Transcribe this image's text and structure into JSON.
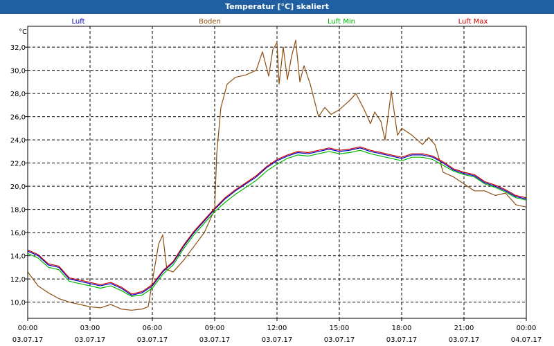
{
  "window": {
    "title": "Temperatur [°C] skaliert"
  },
  "chart_data": {
    "type": "line",
    "title": "Temperatur [°C] skaliert",
    "ylabel": "°C",
    "xlabel": "",
    "ylim": [
      8.6,
      33.8
    ],
    "y_ticks": [
      "10,0",
      "12,0",
      "14,0",
      "16,0",
      "18,0",
      "20,0",
      "22,0",
      "24,0",
      "26,0",
      "28,0",
      "30,0",
      "32,0"
    ],
    "x_range_hours": [
      0,
      24
    ],
    "x_ticks": [
      {
        "time": "00:00",
        "date": "03.07.17"
      },
      {
        "time": "03:00",
        "date": "03.07.17"
      },
      {
        "time": "06:00",
        "date": "03.07.17"
      },
      {
        "time": "09:00",
        "date": "03.07.17"
      },
      {
        "time": "12:00",
        "date": "03.07.17"
      },
      {
        "time": "15:00",
        "date": "03.07.17"
      },
      {
        "time": "18:00",
        "date": "03.07.17"
      },
      {
        "time": "21:00",
        "date": "03.07.17"
      },
      {
        "time": "00:00",
        "date": "04.07.17"
      }
    ],
    "grid": true,
    "legend_position": "top",
    "series": [
      {
        "name": "Luft",
        "color": "#0000c8",
        "x": [
          0,
          0.5,
          1,
          1.5,
          2,
          2.5,
          3,
          3.5,
          4,
          4.5,
          5,
          5.5,
          6,
          6.5,
          7,
          7.5,
          8,
          8.5,
          9,
          9.5,
          10,
          10.5,
          11,
          11.5,
          12,
          12.5,
          13,
          13.5,
          14,
          14.5,
          15,
          15.5,
          16,
          16.5,
          17,
          17.5,
          18,
          18.5,
          19,
          19.5,
          20,
          20.5,
          21,
          21.5,
          22,
          22.5,
          23,
          23.5,
          24
        ],
        "y": [
          14.4,
          14.0,
          13.2,
          13.0,
          12.0,
          11.8,
          11.6,
          11.4,
          11.6,
          11.2,
          10.6,
          10.8,
          11.4,
          12.6,
          13.4,
          14.8,
          16.0,
          17.0,
          18.0,
          18.9,
          19.6,
          20.2,
          20.8,
          21.6,
          22.2,
          22.6,
          22.9,
          22.8,
          23.0,
          23.2,
          23.0,
          23.1,
          23.3,
          23.0,
          22.8,
          22.6,
          22.4,
          22.7,
          22.7,
          22.5,
          22.0,
          21.4,
          21.1,
          20.9,
          20.3,
          20.0,
          19.6,
          19.1,
          18.9
        ]
      },
      {
        "name": "Boden",
        "color": "#8b4c0e",
        "x": [
          0,
          0.5,
          1,
          1.5,
          2,
          2.5,
          3,
          3.5,
          4,
          4.5,
          5,
          5.5,
          5.8,
          6,
          6.3,
          6.5,
          6.7,
          7,
          7.5,
          8,
          8.5,
          8.8,
          9,
          9.1,
          9.3,
          9.6,
          10,
          10.5,
          11,
          11.3,
          11.6,
          11.8,
          12,
          12.1,
          12.3,
          12.5,
          12.7,
          12.9,
          13.1,
          13.3,
          13.6,
          14,
          14.3,
          14.6,
          15,
          15.5,
          15.8,
          16.2,
          16.5,
          16.7,
          17,
          17.2,
          17.5,
          17.8,
          18,
          18.5,
          19,
          19.3,
          19.6,
          20,
          20.5,
          21,
          21.5,
          22,
          22.5,
          23,
          23.5,
          24
        ],
        "y": [
          12.6,
          11.4,
          10.8,
          10.3,
          10.0,
          9.8,
          9.6,
          9.5,
          9.8,
          9.4,
          9.3,
          9.4,
          9.6,
          11.8,
          15.0,
          15.8,
          12.8,
          12.6,
          13.6,
          14.8,
          16.0,
          17.2,
          18.0,
          22.8,
          26.8,
          28.8,
          29.4,
          29.6,
          30.0,
          31.6,
          29.5,
          31.8,
          32.4,
          28.8,
          32.0,
          29.2,
          31.2,
          32.6,
          29.0,
          30.4,
          28.8,
          26.0,
          26.8,
          26.2,
          26.6,
          27.4,
          28.0,
          26.6,
          25.4,
          26.4,
          25.6,
          24.0,
          28.2,
          24.4,
          25.0,
          24.4,
          23.6,
          24.2,
          23.6,
          21.2,
          20.8,
          20.2,
          19.6,
          19.6,
          19.2,
          19.4,
          18.4,
          18.2
        ]
      },
      {
        "name": "Luft Min",
        "color": "#00b400",
        "x": [
          0,
          0.5,
          1,
          1.5,
          2,
          2.5,
          3,
          3.5,
          4,
          4.5,
          5,
          5.5,
          6,
          6.5,
          7,
          7.5,
          8,
          8.5,
          9,
          9.5,
          10,
          10.5,
          11,
          11.5,
          12,
          12.5,
          13,
          13.5,
          14,
          14.5,
          15,
          15.5,
          16,
          16.5,
          17,
          17.5,
          18,
          18.5,
          19,
          19.5,
          20,
          20.5,
          21,
          21.5,
          22,
          22.5,
          23,
          23.5,
          24
        ],
        "y": [
          14.2,
          13.8,
          13.0,
          12.8,
          11.8,
          11.6,
          11.4,
          11.2,
          11.4,
          11.0,
          10.5,
          10.6,
          11.2,
          12.4,
          13.2,
          14.6,
          15.8,
          16.8,
          17.8,
          18.6,
          19.3,
          19.9,
          20.5,
          21.3,
          21.9,
          22.4,
          22.7,
          22.6,
          22.8,
          23.0,
          22.8,
          22.9,
          23.1,
          22.8,
          22.6,
          22.4,
          22.2,
          22.5,
          22.5,
          22.3,
          21.8,
          21.3,
          21.0,
          20.8,
          20.2,
          19.9,
          19.5,
          19.0,
          18.8
        ]
      },
      {
        "name": "Luft Max",
        "color": "#c80000",
        "x": [
          0,
          0.5,
          1,
          1.5,
          2,
          2.5,
          3,
          3.5,
          4,
          4.5,
          5,
          5.5,
          6,
          6.5,
          7,
          7.5,
          8,
          8.5,
          9,
          9.5,
          10,
          10.5,
          11,
          11.5,
          12,
          12.5,
          13,
          13.5,
          14,
          14.5,
          15,
          15.5,
          16,
          16.5,
          17,
          17.5,
          18,
          18.5,
          19,
          19.5,
          20,
          20.5,
          21,
          21.5,
          22,
          22.5,
          23,
          23.5,
          24
        ],
        "y": [
          14.5,
          14.1,
          13.3,
          13.1,
          12.1,
          11.9,
          11.7,
          11.5,
          11.7,
          11.3,
          10.7,
          10.9,
          11.5,
          12.7,
          13.5,
          14.9,
          16.1,
          17.1,
          18.1,
          19.0,
          19.7,
          20.3,
          20.9,
          21.7,
          22.3,
          22.7,
          23.0,
          22.9,
          23.1,
          23.3,
          23.1,
          23.2,
          23.4,
          23.1,
          22.9,
          22.7,
          22.5,
          22.8,
          22.8,
          22.6,
          22.1,
          21.5,
          21.2,
          21.0,
          20.4,
          20.1,
          19.7,
          19.2,
          19.0
        ]
      }
    ]
  }
}
